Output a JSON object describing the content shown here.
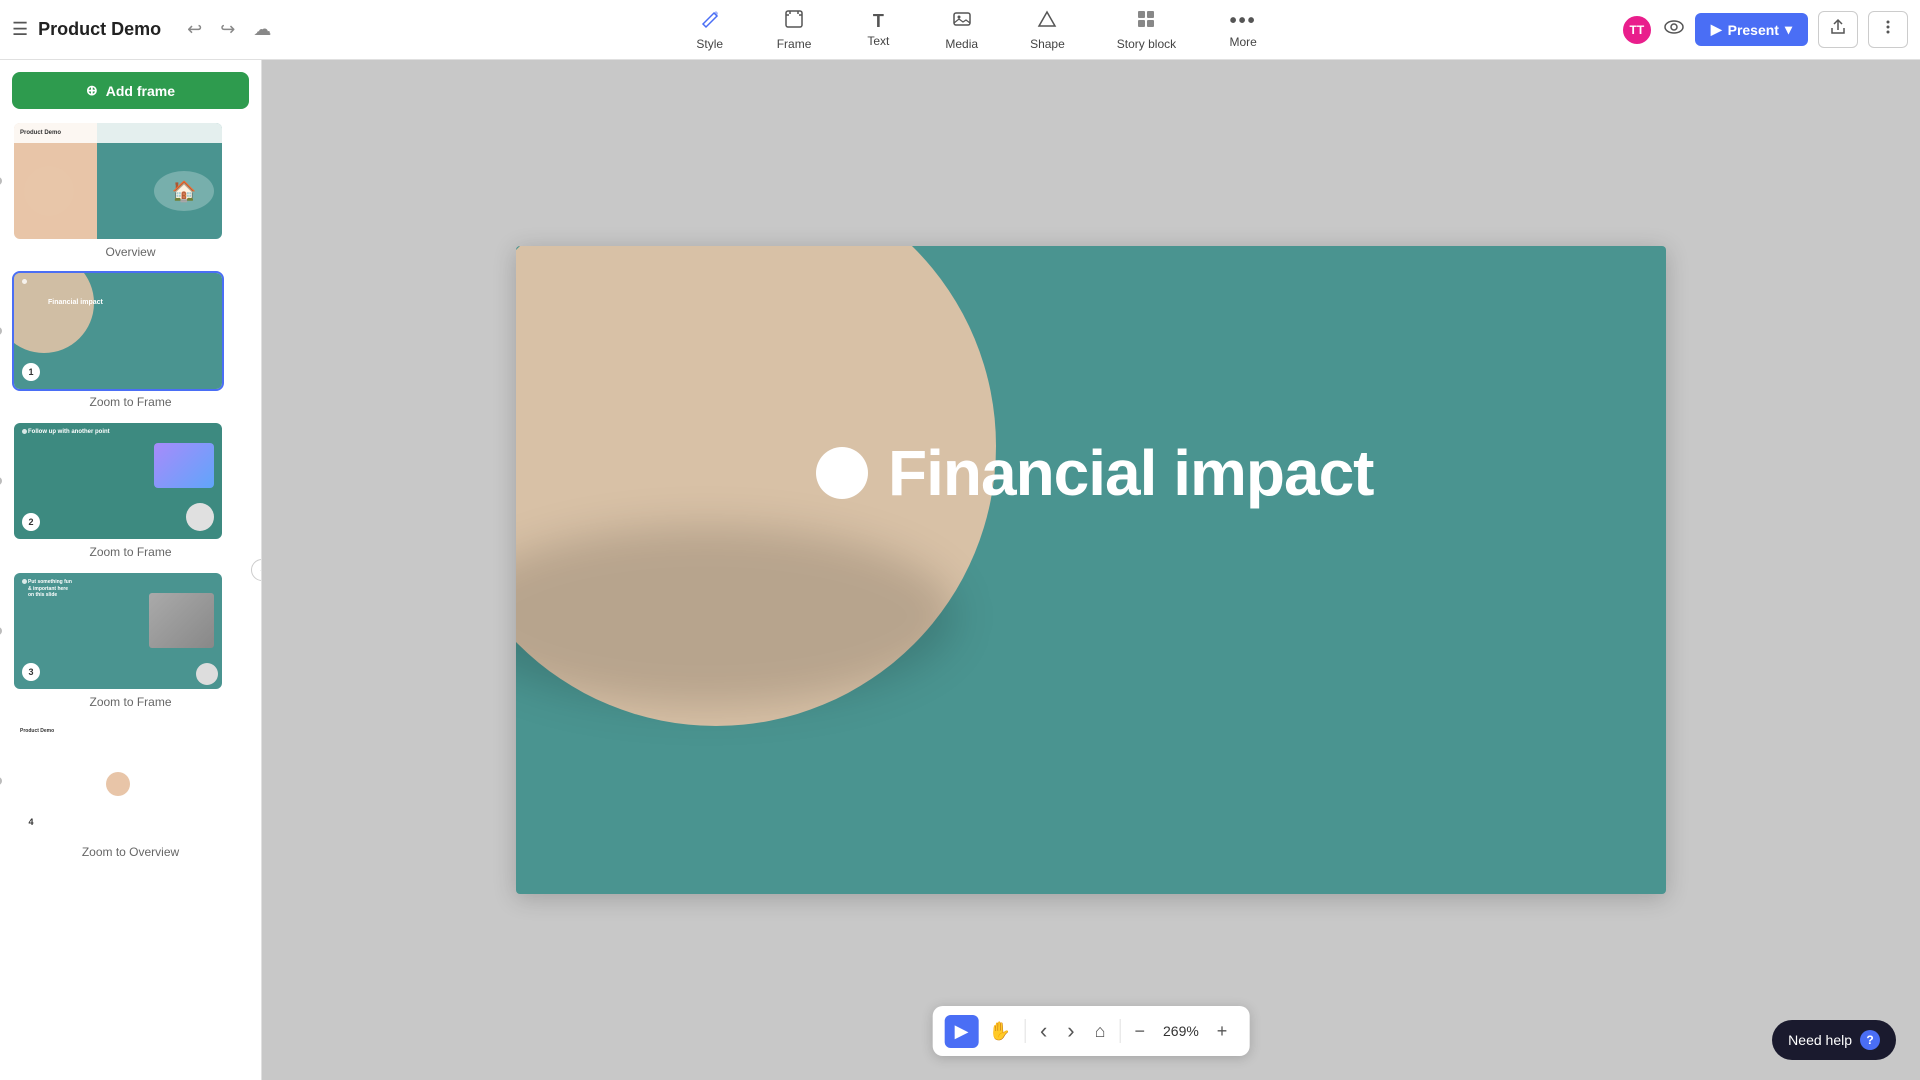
{
  "app": {
    "title": "Product Demo",
    "hamburger": "☰"
  },
  "topbar": {
    "undo_label": "↩",
    "redo_label": "↪",
    "cloud_label": "☁",
    "tools": [
      {
        "id": "style",
        "icon": "✏️",
        "label": "Style",
        "active": true
      },
      {
        "id": "frame",
        "icon": "⬜",
        "label": "Frame",
        "active": false
      },
      {
        "id": "text",
        "icon": "T",
        "label": "Text",
        "active": false
      },
      {
        "id": "media",
        "icon": "🖼",
        "label": "Media",
        "active": false
      },
      {
        "id": "shape",
        "icon": "◆",
        "label": "Shape",
        "active": false
      },
      {
        "id": "storyblock",
        "icon": "⬛",
        "label": "Story block",
        "active": false
      },
      {
        "id": "more",
        "icon": "•••",
        "label": "More",
        "active": false
      }
    ],
    "avatar_initials": "TT",
    "present_label": "Present",
    "share_icon": "⬆"
  },
  "sidebar": {
    "add_frame_label": "Add frame",
    "slides": [
      {
        "id": "slide-overview",
        "label": "Overview",
        "active": false,
        "type": "overview"
      },
      {
        "id": "slide-financial",
        "label": "Zoom to Frame",
        "active": true,
        "type": "financial",
        "number": "1",
        "thumb_label": "Financial impact"
      },
      {
        "id": "slide-followup",
        "label": "Zoom to Frame",
        "active": false,
        "type": "followup",
        "number": "2",
        "thumb_label": "Follow up with another point"
      },
      {
        "id": "slide-4",
        "label": "Zoom to Frame",
        "active": false,
        "type": "slide4",
        "number": "3",
        "thumb_label": "Put something fun & important here"
      },
      {
        "id": "slide-5",
        "label": "Zoom to Overview",
        "active": false,
        "type": "slide5",
        "number": "4",
        "thumb_label": "Product Demo"
      }
    ]
  },
  "canvas": {
    "title": "Financial impact",
    "zoom_level": "269%"
  },
  "bottom_toolbar": {
    "play_icon": "▶",
    "hand_icon": "✋",
    "prev_icon": "‹",
    "next_icon": "›",
    "home_icon": "⌂",
    "zoom_out_icon": "−",
    "zoom_in_icon": "+",
    "zoom_level": "269%"
  },
  "need_help": {
    "label": "Need help",
    "icon": "?"
  }
}
